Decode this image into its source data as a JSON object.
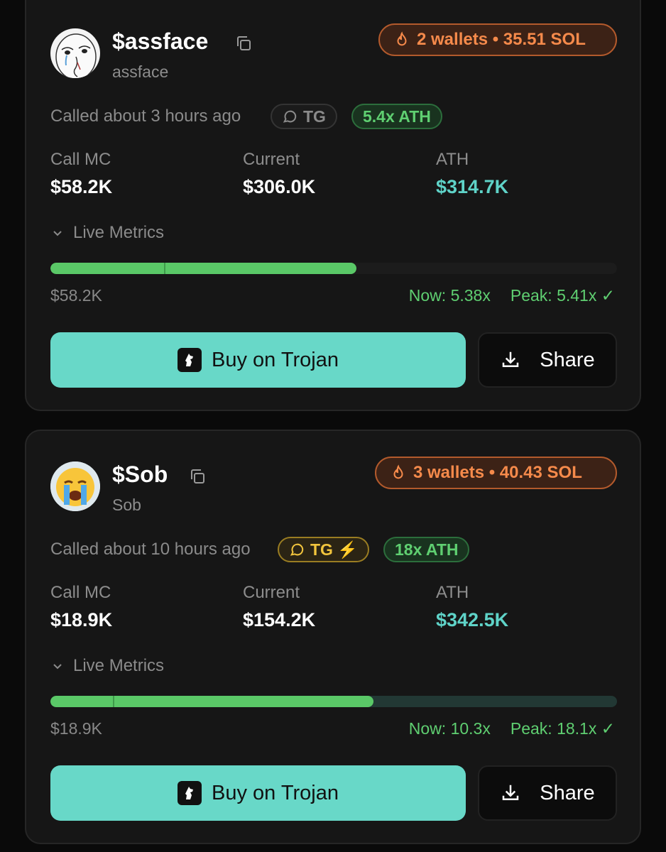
{
  "cards": [
    {
      "symbol": "$assface",
      "name": "assface",
      "wallets": "2 wallets • 35.51 SOL",
      "called": "Called about 3 hours ago",
      "tg_label": "TG",
      "tg_style": "plain",
      "ath_multiple": "5.4x ATH",
      "call_mc_label": "Call MC",
      "call_mc": "$58.2K",
      "current_label": "Current",
      "current": "$306.0K",
      "ath_label": "ATH",
      "ath": "$314.7K",
      "live_metrics": "Live Metrics",
      "progress_fraction": 0.54,
      "base_mc": "$58.2K",
      "now": "Now: 5.38x",
      "peak": "Peak: 5.41x ✓",
      "buy_label": "Buy on Trojan",
      "share_label": "Share"
    },
    {
      "symbol": "$Sob",
      "name": "Sob",
      "wallets": "3 wallets • 40.43 SOL",
      "called": "Called about 10 hours ago",
      "tg_label": "TG ⚡",
      "tg_style": "gold",
      "ath_multiple": "18x ATH",
      "call_mc_label": "Call MC",
      "call_mc": "$18.9K",
      "current_label": "Current",
      "current": "$154.2K",
      "ath_label": "ATH",
      "ath": "$342.5K",
      "live_metrics": "Live Metrics",
      "progress_fraction": 0.57,
      "base_mc": "$18.9K",
      "now": "Now: 10.3x",
      "peak": "Peak: 18.1x ✓",
      "buy_label": "Buy on Trojan",
      "share_label": "Share"
    }
  ],
  "colors": {
    "accent_teal": "#68d8c8",
    "wallet_orange": "#f58a4b",
    "positive_green": "#5fcf71",
    "tg_gold": "#f2c53d"
  },
  "icons": [
    "meme-face-avatar",
    "crying-emoji-avatar",
    "copy-icon",
    "fire-icon",
    "chat-bubble-icon",
    "chevron-down-icon",
    "trojan-horse-icon",
    "download-icon"
  ]
}
